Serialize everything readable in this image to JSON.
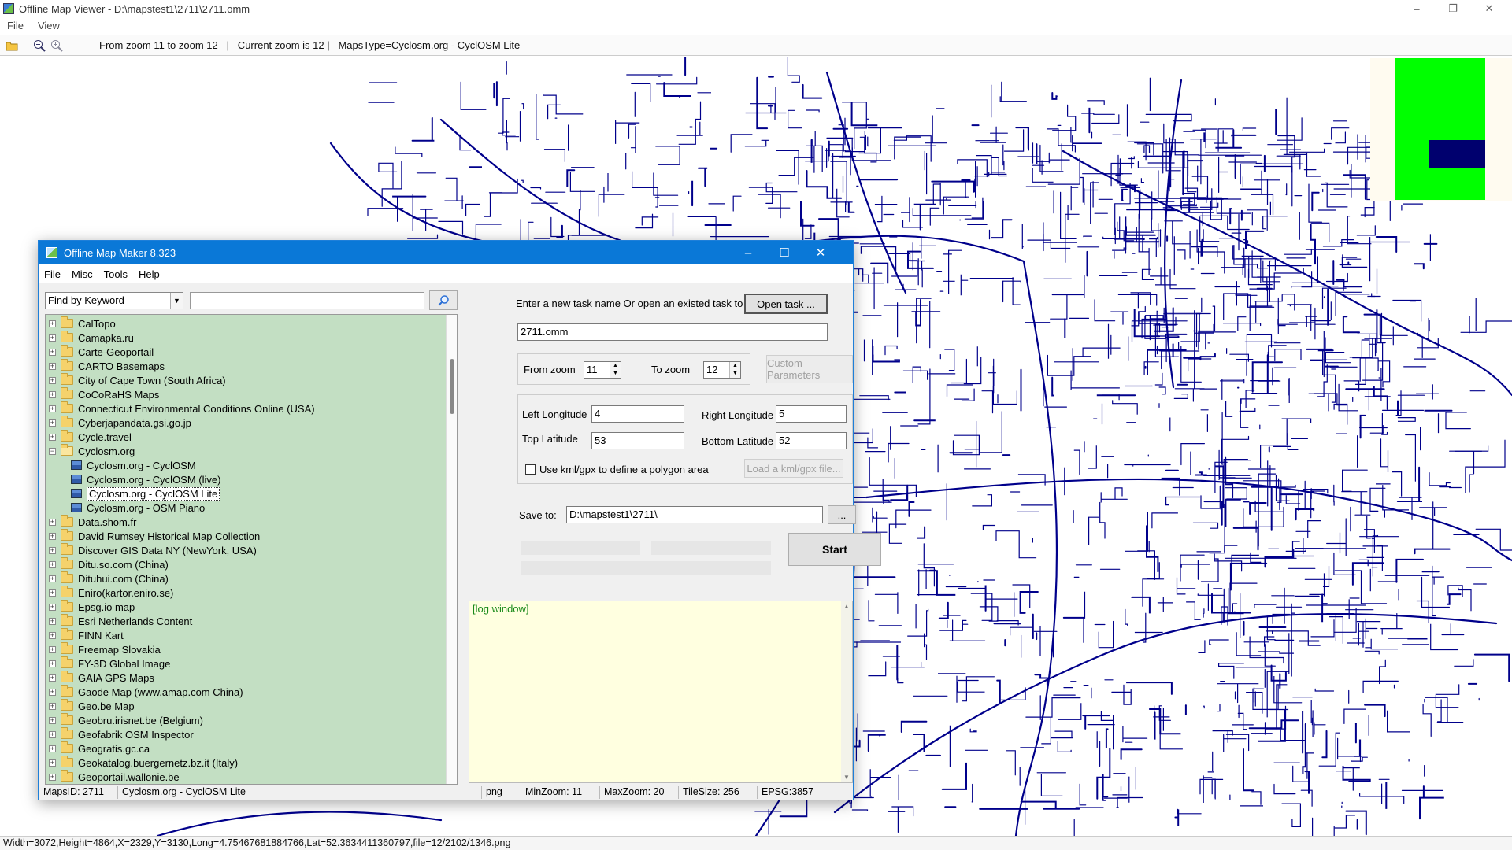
{
  "viewer": {
    "title": "Offline Map Viewer - D:\\mapstest1\\2711\\2711.omm",
    "menu": [
      "File",
      "View"
    ],
    "toolbar_text": "From zoom 11 to zoom 12   |   Current zoom is 12 |   MapsType=Cyclosm.org - CyclOSM Lite",
    "status": "Width=3072,Height=4864,X=2329,Y=3130,Long=4.75467681884766,Lat=52.3634411360797,file=12/2102/1346.png"
  },
  "colors": {
    "road": "#00008b",
    "minimap_area": "#00ff00",
    "minimap_view": "#00006e",
    "tree_bg": "#c3dfc3",
    "log_bg": "#ffffe0",
    "dialog_title": "#0a78d7"
  },
  "dialog": {
    "title": "Offline Map Maker 8.323",
    "menu": [
      "File",
      "Misc",
      "Tools",
      "Help"
    ],
    "find_mode": "Find by Keyword",
    "search_value": "",
    "tree": [
      {
        "label": "CalTopo",
        "type": "folder"
      },
      {
        "label": "Camapka.ru",
        "type": "folder"
      },
      {
        "label": "Carte-Geoportail",
        "type": "folder"
      },
      {
        "label": "CARTO Basemaps",
        "type": "folder"
      },
      {
        "label": "City of Cape Town (South Africa)",
        "type": "folder"
      },
      {
        "label": "CoCoRaHS Maps",
        "type": "folder"
      },
      {
        "label": "Connecticut Environmental Conditions Online (USA)",
        "type": "folder"
      },
      {
        "label": "Cyberjapandata.gsi.go.jp",
        "type": "folder"
      },
      {
        "label": "Cycle.travel",
        "type": "folder"
      },
      {
        "label": "Cyclosm.org",
        "type": "folder-open"
      },
      {
        "label": "Cyclosm.org - CyclOSM",
        "type": "map"
      },
      {
        "label": "Cyclosm.org - CyclOSM (live)",
        "type": "map"
      },
      {
        "label": "Cyclosm.org - CyclOSM Lite",
        "type": "map-selected"
      },
      {
        "label": "Cyclosm.org - OSM Piano",
        "type": "map"
      },
      {
        "label": "Data.shom.fr",
        "type": "folder"
      },
      {
        "label": "David Rumsey Historical Map Collection",
        "type": "folder"
      },
      {
        "label": "Discover GIS Data NY (NewYork, USA)",
        "type": "folder"
      },
      {
        "label": "Ditu.so.com (China)",
        "type": "folder"
      },
      {
        "label": "Dituhui.com (China)",
        "type": "folder"
      },
      {
        "label": "Eniro(kartor.eniro.se)",
        "type": "folder"
      },
      {
        "label": "Epsg.io map",
        "type": "folder"
      },
      {
        "label": "Esri Netherlands Content",
        "type": "folder"
      },
      {
        "label": "FINN Kart",
        "type": "folder"
      },
      {
        "label": "Freemap Slovakia",
        "type": "folder"
      },
      {
        "label": "FY-3D Global Image",
        "type": "folder"
      },
      {
        "label": "GAIA GPS Maps",
        "type": "folder"
      },
      {
        "label": "Gaode Map (www.amap.com China)",
        "type": "folder"
      },
      {
        "label": "Geo.be Map",
        "type": "folder"
      },
      {
        "label": "Geobru.irisnet.be (Belgium)",
        "type": "folder"
      },
      {
        "label": "Geofabrik OSM Inspector",
        "type": "folder"
      },
      {
        "label": "Geogratis.gc.ca",
        "type": "folder"
      },
      {
        "label": "Geokatalog.buergernetz.bz.it (Italy)",
        "type": "folder"
      },
      {
        "label": "Geoportail.wallonie.be",
        "type": "folder"
      }
    ],
    "task_prompt": "Enter a new task name Or open an existed task to continue:",
    "open_task": "Open task ...",
    "task_name": "2711.omm",
    "from_zoom_label": "From zoom",
    "from_zoom": "11",
    "to_zoom_label": "To zoom",
    "to_zoom": "12",
    "custom_params": "Custom Parameters",
    "left_lon_label": "Left Longitude",
    "left_lon": "4",
    "right_lon_label": "Right Longitude",
    "right_lon": "5",
    "top_lat_label": "Top Latitude",
    "top_lat": "53",
    "bottom_lat_label": "Bottom Latitude",
    "bottom_lat": "52",
    "kml_label": "Use kml/gpx to define a polygon area",
    "kml_btn": "Load a kml/gpx file...",
    "save_label": "Save to:",
    "save_path": "D:\\mapstest1\\2711\\",
    "browse": "...",
    "start": "Start",
    "log": "[log window]",
    "status": {
      "maps_id": "MapsID: 2711",
      "map_name": "Cyclosm.org - CyclOSM Lite",
      "format": "png",
      "min_zoom": "MinZoom: 11",
      "max_zoom": "MaxZoom: 20",
      "tile_size": "TileSize: 256",
      "epsg": "EPSG:3857"
    }
  }
}
